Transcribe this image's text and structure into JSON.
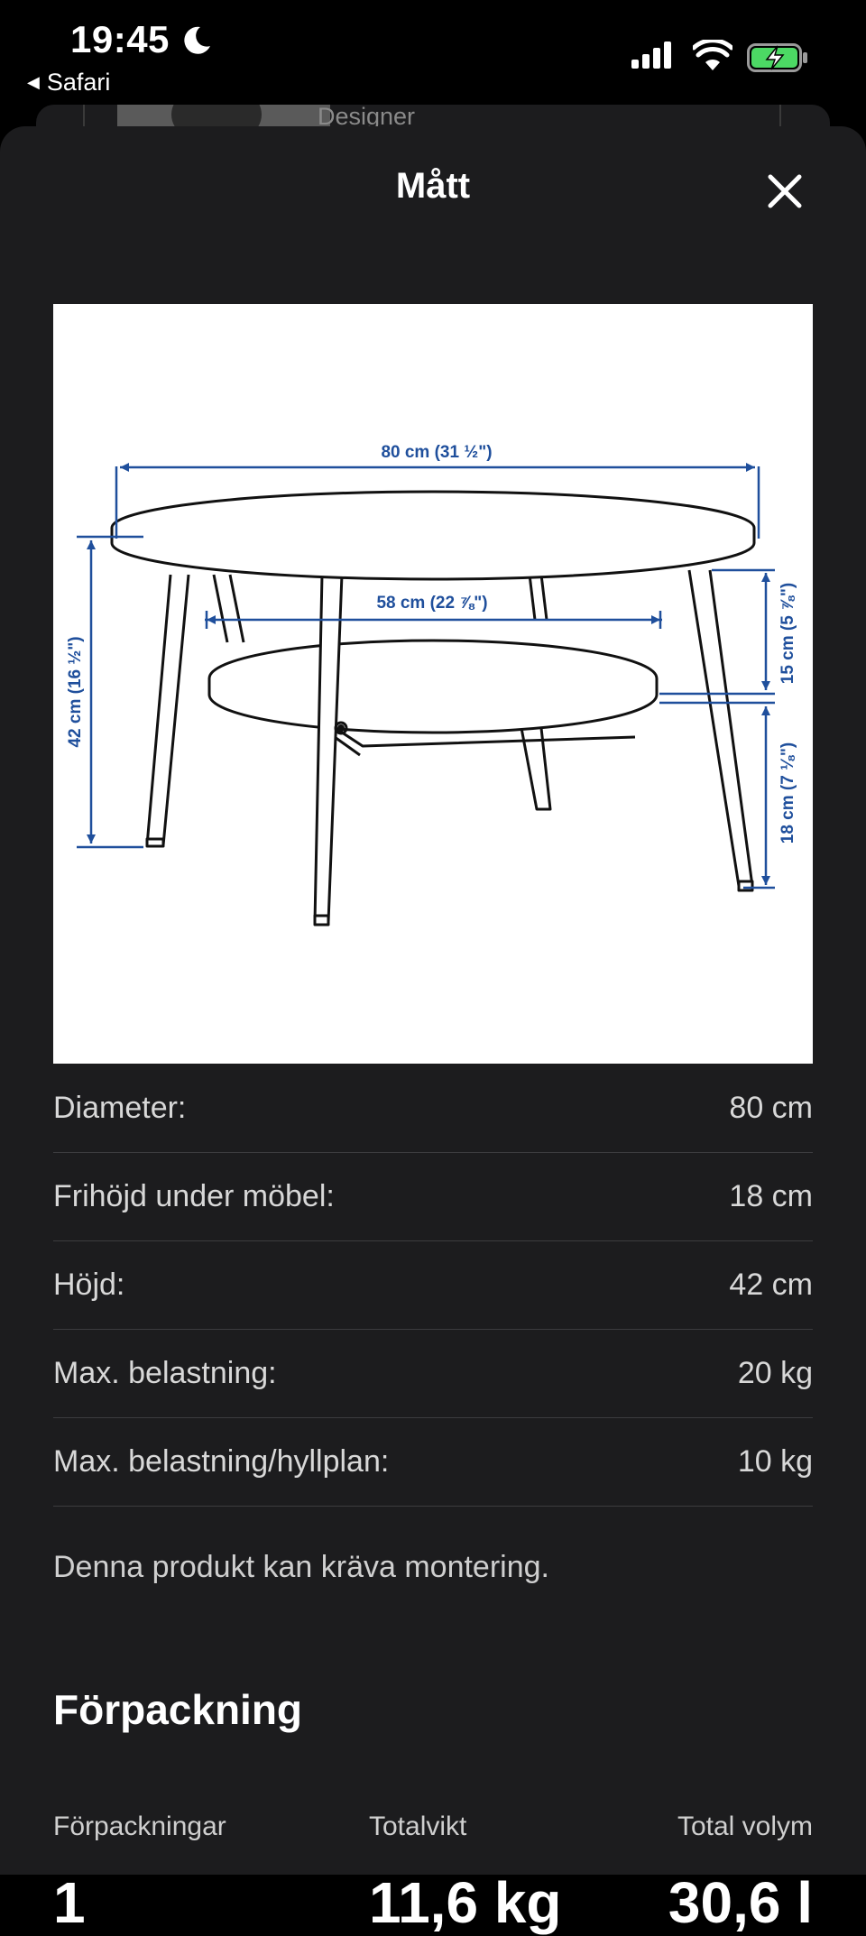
{
  "status_bar": {
    "time": "19:45",
    "back_app": "Safari"
  },
  "background_page": {
    "label": "Designer"
  },
  "sheet": {
    "title": "Mått"
  },
  "diagram": {
    "labels": {
      "width": "80 cm (31 ½\")",
      "shelf_width": "58 cm (22 ⅞\")",
      "height": "42 cm (16 ½\")",
      "shelf_gap": "15 cm (5 ⅞\")",
      "clearance": "18 cm (7 ⅛\")"
    },
    "line_color": "#1f4f9c"
  },
  "specs": [
    {
      "label": "Diameter:",
      "value": "80 cm"
    },
    {
      "label": "Frihöjd under möbel:",
      "value": "18 cm"
    },
    {
      "label": "Höjd:",
      "value": "42 cm"
    },
    {
      "label": "Max. belastning:",
      "value": "20 kg"
    },
    {
      "label": "Max. belastning/hyllplan:",
      "value": "10 kg"
    }
  ],
  "note": "Denna produkt kan kräva montering.",
  "packaging": {
    "title": "Förpackning",
    "columns": [
      {
        "label": "Förpackningar",
        "value": "1"
      },
      {
        "label": "Totalvikt",
        "value": "11,6 kg"
      },
      {
        "label": "Total volym",
        "value": "30,6 l"
      }
    ]
  },
  "colors": {
    "sheet_bg": "#1c1c1e",
    "battery_green": "#4cd964"
  }
}
